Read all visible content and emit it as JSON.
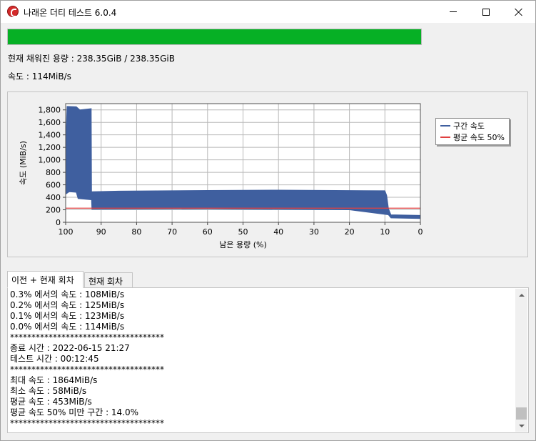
{
  "window": {
    "title": "나래온 더티 테스트 6.0.4",
    "controls": {
      "minimize": "minimize",
      "maximize": "maximize",
      "close": "close"
    }
  },
  "progress": {
    "fraction": 1.0,
    "color": "#06b025"
  },
  "status": {
    "capacity_line": "현재 채워진 용량 : 238.35GiB / 238.35GiB",
    "speed_line": "속도 : 114MiB/s"
  },
  "chart_data": {
    "type": "line",
    "xlabel": "남은 용량 (%)",
    "ylabel": "속도 (MiB/s)",
    "xlim": [
      100,
      0
    ],
    "ylim": [
      0,
      1900
    ],
    "x_ticks": [
      "100",
      "90",
      "80",
      "70",
      "60",
      "50",
      "40",
      "30",
      "20",
      "10",
      "0"
    ],
    "y_ticks": [
      "0",
      "200",
      "400",
      "600",
      "800",
      "1,000",
      "1,200",
      "1,400",
      "1,600",
      "1,800"
    ],
    "grid": true,
    "legend_position": "right",
    "series": [
      {
        "name": "구간 속도",
        "color": "#3f5f9f",
        "envelope_max": [
          [
            100,
            1200
          ],
          [
            99.6,
            1855
          ],
          [
            97,
            1850
          ],
          [
            96,
            1800
          ],
          [
            92.8,
            1820
          ],
          [
            92.7,
            490
          ],
          [
            85,
            500
          ],
          [
            60,
            510
          ],
          [
            40,
            515
          ],
          [
            10,
            505
          ],
          [
            9.5,
            430
          ],
          [
            9,
            220
          ],
          [
            8.3,
            120
          ],
          [
            0,
            110
          ]
        ],
        "envelope_min": [
          [
            100,
            450
          ],
          [
            99,
            490
          ],
          [
            97,
            480
          ],
          [
            96.5,
            380
          ],
          [
            92.7,
            360
          ],
          [
            92.6,
            210
          ],
          [
            60,
            215
          ],
          [
            20,
            200
          ],
          [
            9,
            120
          ],
          [
            8.3,
            70
          ],
          [
            0,
            60
          ]
        ]
      },
      {
        "name": "평균 속도 50%",
        "color": "#e04040",
        "x": [
          100,
          0
        ],
        "y": [
          226,
          226
        ]
      }
    ]
  },
  "tabs": [
    {
      "label": "이전 + 현재 회차",
      "active": true
    },
    {
      "label": "현재 회차",
      "active": false
    }
  ],
  "log": {
    "lines": [
      "0.3% 에서의 속도 : 108MiB/s",
      "0.2% 에서의 속도 : 125MiB/s",
      "0.1% 에서의 속도 : 123MiB/s",
      "0.0% 에서의 속도 : 114MiB/s",
      "************************************",
      "종료 시간 : 2022-06-15 21:27",
      "테스트 시간 : 00:12:45",
      "************************************",
      "최대 속도 : 1864MiB/s",
      "최소 속도 : 58MiB/s",
      "평균 속도 : 453MiB/s",
      "평균 속도 50% 미만 구간 : 14.0%",
      "************************************"
    ],
    "scroll_position": 0.95
  }
}
